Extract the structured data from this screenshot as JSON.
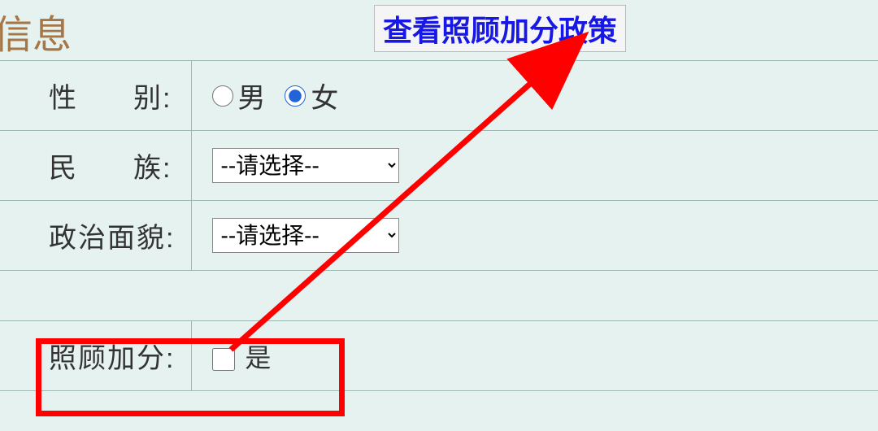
{
  "section": {
    "title": "信息"
  },
  "policy": {
    "link_text": "查看照顾加分政策"
  },
  "form": {
    "gender": {
      "label_a": "性",
      "label_b": "别:",
      "male": "男",
      "female": "女",
      "selected": "female"
    },
    "ethnicity": {
      "label_a": "民",
      "label_b": "族:",
      "placeholder": "--请选择--"
    },
    "politics": {
      "label": "政治面貌:",
      "placeholder": "--请选择--"
    },
    "bonus": {
      "label": "照顾加分:",
      "option": "是"
    }
  }
}
